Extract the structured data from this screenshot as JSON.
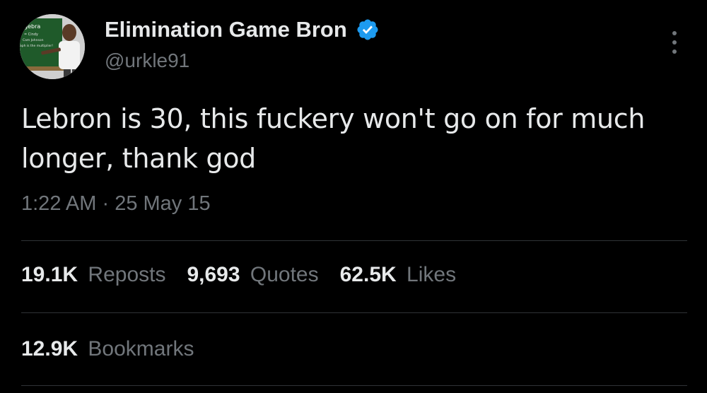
{
  "author": {
    "display_name": "Elimination Game Bron",
    "handle": "@urkle91",
    "verified": true,
    "avatar_text": [
      "gebra",
      "= Cindy",
      "Cam Johnson",
      "aph is the multiplier!"
    ]
  },
  "tweet": {
    "text": "Lebron is 30, this fuckery won't go on for much longer, thank god",
    "time": "1:22 AM",
    "separator": "·",
    "date": "25 May 15"
  },
  "stats": {
    "reposts": {
      "count": "19.1K",
      "label": "Reposts"
    },
    "quotes": {
      "count": "9,693",
      "label": "Quotes"
    },
    "likes": {
      "count": "62.5K",
      "label": "Likes"
    },
    "bookmarks": {
      "count": "12.9K",
      "label": "Bookmarks"
    }
  },
  "colors": {
    "background": "#000000",
    "primary_text": "#e7e9ea",
    "secondary_text": "#71767b",
    "divider": "#2f3336",
    "verified_badge": "#1d9bf0"
  },
  "icons": {
    "verified": "verified-badge-icon",
    "more": "more-dots-vertical-icon"
  }
}
